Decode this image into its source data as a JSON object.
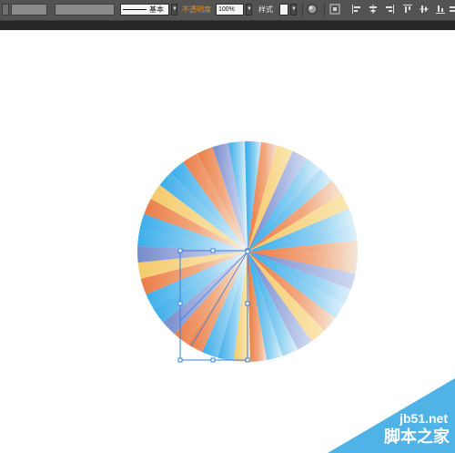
{
  "toolbar": {
    "stroke_style_label": "基本",
    "opacity_label": "不透明度",
    "opacity_value": "100%",
    "style_label": "样式",
    "colors": {
      "panel": "#535353",
      "opacity_label": "#f08a1e"
    },
    "icons": [
      "globe-icon",
      "transform-grid-icon",
      "align-left-icon",
      "align-center-icon",
      "align-right-icon",
      "align-top-icon",
      "align-middle-icon",
      "align-bottom-icon",
      "distribute-icon"
    ]
  },
  "artwork": {
    "colors": {
      "orange": "#e8733a",
      "light_blue": "#2aa6e8",
      "pale": "#f5f0e6",
      "periwinkle": "#6c82c9",
      "yellow": "#f4c560",
      "selection": "#3d7fd9"
    }
  },
  "watermark": {
    "url": "jb51.net",
    "site_name": "脚本之家",
    "color": "#4fb3e8"
  }
}
